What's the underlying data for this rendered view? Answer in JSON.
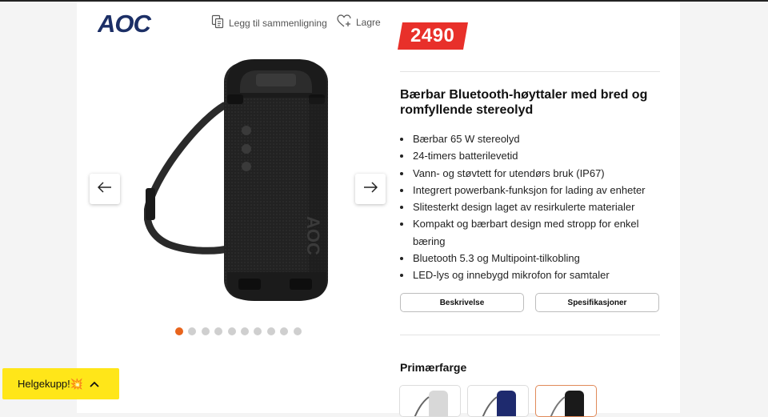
{
  "brand": {
    "name": "AOC"
  },
  "toolbar": {
    "compare_label": "Legg til sammenligning",
    "save_label": "Lagre"
  },
  "price": {
    "value": "2490"
  },
  "product": {
    "title": "Bærbar Bluetooth-høyttaler med bred og romfyllende stereolyd",
    "features": [
      "Bærbar 65 W stereolyd",
      "24-timers batterilevetid",
      "Vann- og støvtett for utendørs bruk (IP67)",
      "Integrert powerbank-funksjon for lading av enheter",
      "Slitesterkt design laget av resirkulerte materialer",
      "Kompakt og bærbart design med stropp for enkel bæring",
      "Bluetooth 5.3 og Multipoint-tilkobling",
      "LED-lys og innebygd mikrofon for samtaler"
    ],
    "image_brand_text": "AOC"
  },
  "tabs": {
    "description_label": "Beskrivelse",
    "specs_label": "Spesifikasjoner"
  },
  "color_section": {
    "title": "Primærfarge",
    "swatches": [
      {
        "color": "#d8d8d8",
        "selected": false
      },
      {
        "color": "#1e2a6e",
        "selected": false
      },
      {
        "color": "#1a1a1a",
        "selected": true
      }
    ]
  },
  "gallery": {
    "total_images": 10,
    "active_index": 0,
    "accent_color": "#e8641c"
  },
  "deal_banner": {
    "label": "Helgekupp!💥",
    "icon": "chevron-up-icon",
    "color": "#ffe619"
  },
  "colors": {
    "price_bg": "#e8302a",
    "brand_blue": "#1c2f66"
  }
}
